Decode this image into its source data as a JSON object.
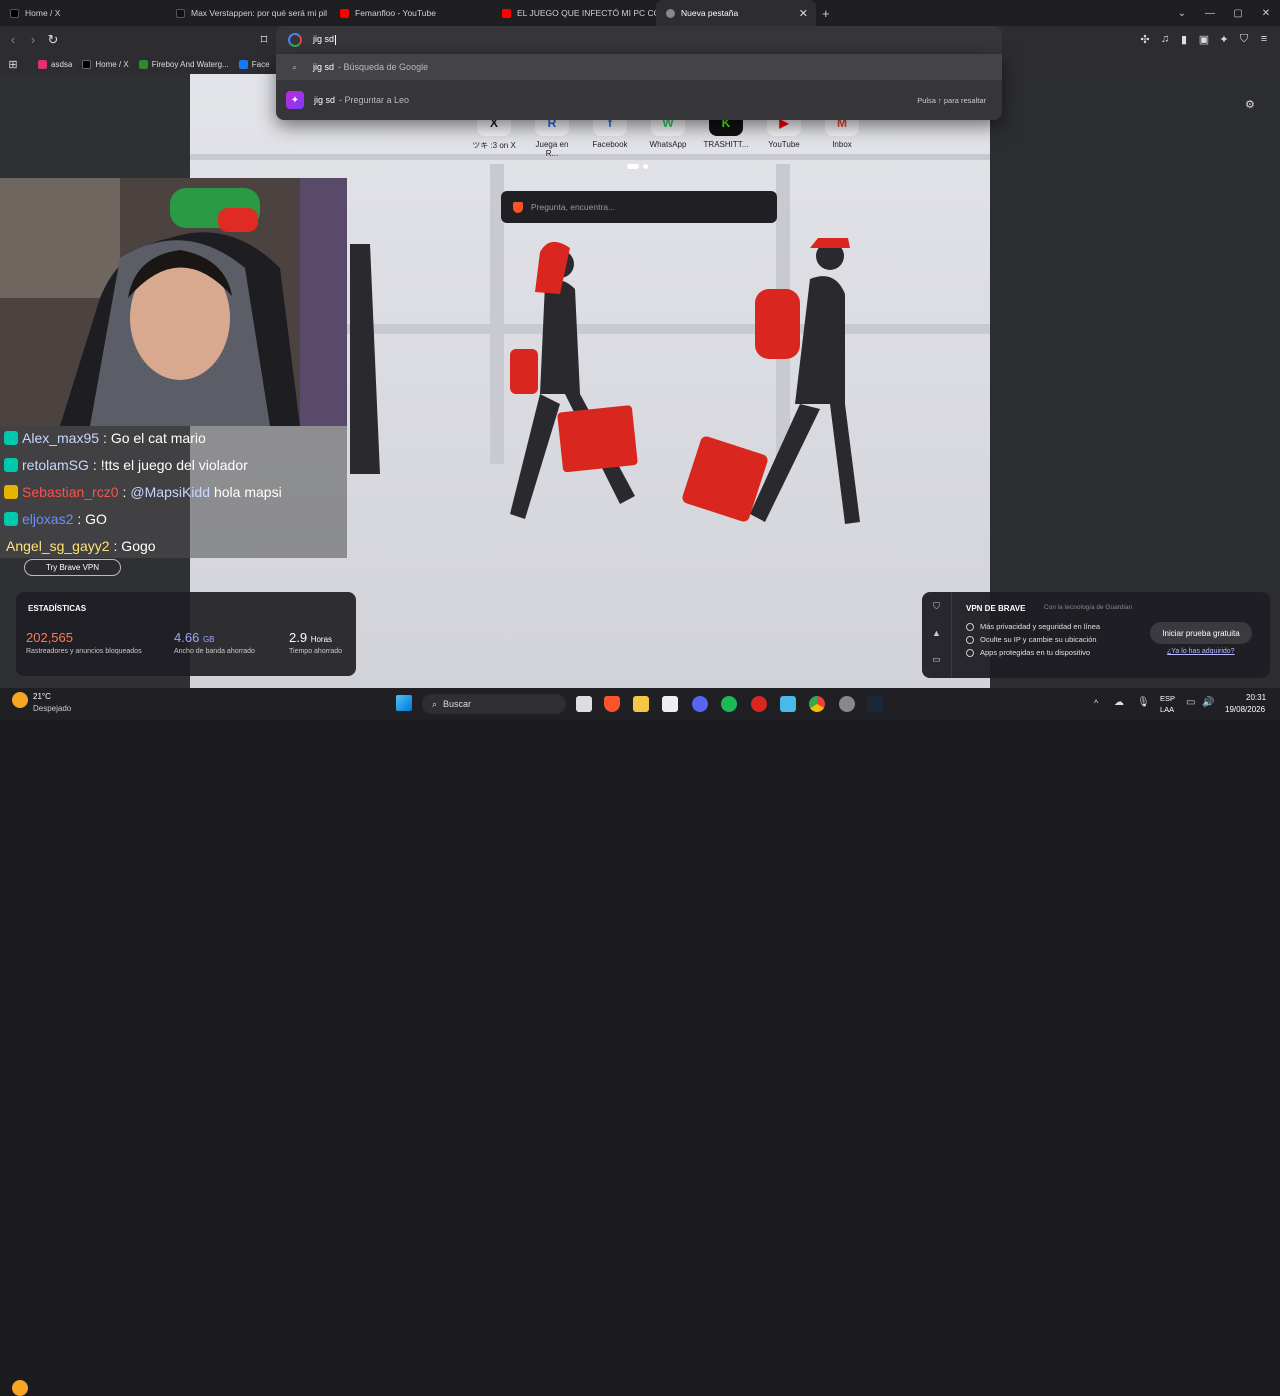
{
  "tabs": [
    {
      "label": "Home / X",
      "color": "#000000"
    },
    {
      "label": "Max Verstappen: por qué será mi pil",
      "color": "#111111"
    },
    {
      "label": "Femanfloo - YouTube",
      "color": "#ff0000"
    },
    {
      "label": "EL JUEGO QUE INFECTÓ MI PC CON",
      "color": "#ff0000"
    },
    {
      "label": "Nueva pestaña",
      "color": "#888888",
      "active": true
    }
  ],
  "omnibox": {
    "value": "jig sd"
  },
  "suggestions": [
    {
      "query": "jig sd",
      "suffix": "- Búsqueda de Google"
    },
    {
      "query": "jig sd",
      "suffix": "- Preguntar a Leo",
      "hint": "Pulsa ↑ para resaltar"
    }
  ],
  "bookmarks": [
    {
      "label": "asdsa",
      "color": "#e1306c"
    },
    {
      "label": "Home / X",
      "color": "#000000"
    },
    {
      "label": "Fireboy And Waterg...",
      "color": "#2d8a2d"
    },
    {
      "label": "Face",
      "color": "#1877f2"
    }
  ],
  "shortcuts": [
    {
      "label": "ツキ :3 on X",
      "icon": "X"
    },
    {
      "label": "Juega en R...",
      "icon": "R"
    },
    {
      "label": "Facebook",
      "icon": "f"
    },
    {
      "label": "WhatsApp",
      "icon": "W"
    },
    {
      "label": "TRASHITT...",
      "icon": "K"
    },
    {
      "label": "YouTube",
      "icon": "▶"
    },
    {
      "label": "Inbox",
      "icon": "M"
    }
  ],
  "search_placeholder": "Pregunta, encuentra...",
  "stats": {
    "title": "ESTADÍSTICAS",
    "items": [
      {
        "value": "202,565",
        "unit": "",
        "label": "Rastreadores y anuncios bloqueados",
        "color": "#ff7a52"
      },
      {
        "value": "4.66",
        "unit": "GB",
        "label": "Ancho de banda ahorrado",
        "color": "#9aa6ff"
      },
      {
        "value": "2.9",
        "unit": "Horas",
        "label": "Tiempo ahorrado",
        "color": "#ffffff"
      }
    ]
  },
  "vpn": {
    "title": "VPN DE BRAVE",
    "subtitle": "Con la tecnología de Guardian",
    "features": [
      "Más privacidad y seguridad en línea",
      "Oculte su IP y cambie su ubicación",
      "Apps protegidas en tu dispositivo"
    ],
    "button": "Iniciar prueba gratuita",
    "link": "¿Ya lo has adquirido?"
  },
  "brave_promo": {
    "button": "Try Brave VPN"
  },
  "chat": [
    {
      "user": "Alex_max95",
      "msg": ": Go el cat mario",
      "color": "#c6d7ff",
      "badge": "#00c8af"
    },
    {
      "user": "retolamSG",
      "msg": ": !tts el juego del violador",
      "color": "#c6d7ff",
      "badge": "#00c8af"
    },
    {
      "user": "Sebastian_rcz0",
      "msg": ":",
      "mention": "@MapsiKidd",
      "msg2": "hola mapsi",
      "color": "#ff4f4f",
      "badge": "#e6b400"
    },
    {
      "user": "eljoxas2",
      "msg": ": GO",
      "color": "#6c8cff",
      "badge": "#00c8af"
    },
    {
      "user": "Angel_sg_gayy2",
      "msg": ": Gogo",
      "color": "#ffe27a",
      "badge": ""
    }
  ],
  "taskbar": {
    "weather_temp": "21°C",
    "weather_desc": "Despejado",
    "search": "Buscar",
    "lang1": "ESP",
    "lang2": "LAA",
    "time": "20:31",
    "date": "19/08/2026"
  }
}
